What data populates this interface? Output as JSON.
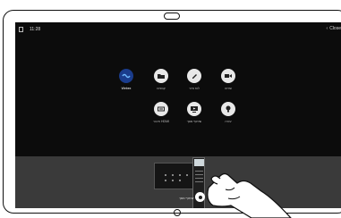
{
  "status_bar": {
    "time": "11:28",
    "back_label": "Close"
  },
  "apps_row1": [
    {
      "label": "Webex",
      "icon": "webex-icon"
    },
    {
      "label": "קבצים",
      "icon": "folder-icon"
    },
    {
      "label": "לוח ציור",
      "icon": "pencil-icon"
    },
    {
      "label": "שיחה",
      "icon": "video-camera-icon"
    }
  ],
  "apps_row2": [
    {
      "label": "חיבור HDMI",
      "icon": "hdmi-icon"
    },
    {
      "label": "שיתוף מסך",
      "icon": "share-screen-icon"
    },
    {
      "label": "עזרה",
      "icon": "lightbulb-icon"
    }
  ],
  "tray": {
    "label": "שיתוף מסך"
  },
  "colors": {
    "screen_bg": "#0c0c0c",
    "tray_bg": "#3a3a3a",
    "icon_bg": "#e8e8e8",
    "webex_bg": "#1a3c8c"
  }
}
